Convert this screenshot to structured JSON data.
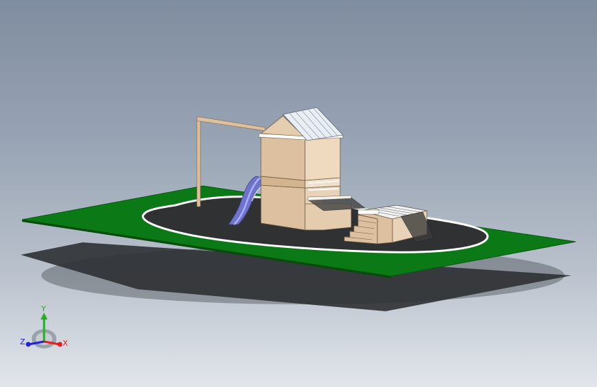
{
  "colors": {
    "ground": "#0b7a16",
    "track": "#2f3133",
    "track_edge": "#ffffff",
    "shadow": "#2e3033",
    "wood": "#ddc09f",
    "wood_dark": "#b89c78",
    "roof": "#e8eef4",
    "slide": "#6f73c9",
    "slide_light": "#a9b0ff",
    "mesh": "#3c3c3c",
    "axis_x": "#e02020",
    "axis_y": "#20b020",
    "axis_z": "#2020e0"
  },
  "triad": {
    "x_label": "X",
    "y_label": "Y",
    "z_label": "Z"
  }
}
